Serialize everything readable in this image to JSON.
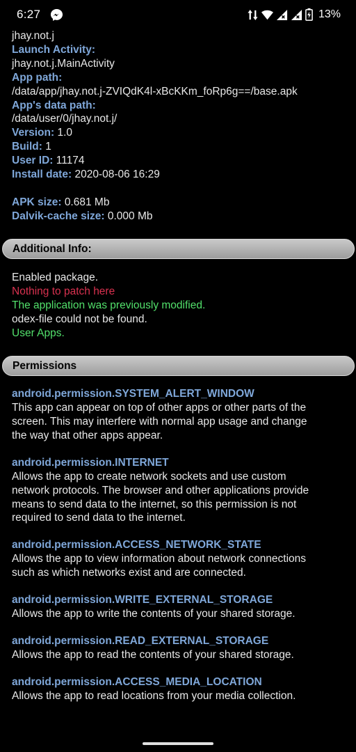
{
  "status_bar": {
    "time": "6:27",
    "battery_pct": "13%",
    "icons": [
      "messenger-icon",
      "data-arrows-icon",
      "wifi-icon",
      "signal-icon",
      "signal-icon",
      "battery-icon"
    ]
  },
  "app_info": {
    "package_value": "jhay.not.j",
    "launch_activity_label": "Launch Activity:",
    "launch_activity_value": "jhay.not.j.MainActivity",
    "app_path_label": "App path:",
    "app_path_value": "/data/app/jhay.not.j-ZVIQdK4l-xBcKKm_foRp6g==/base.apk",
    "data_path_label": "App's data path:",
    "data_path_value": "/data/user/0/jhay.not.j/",
    "version_label": "Version:",
    "version_value": "1.0",
    "build_label": "Build:",
    "build_value": "1",
    "user_id_label": "User ID:",
    "user_id_value": "11174",
    "install_date_label": "Install date:",
    "install_date_value": "2020-08-06 16:29",
    "apk_size_label": "APK size:",
    "apk_size_value": "0.681 Mb",
    "dalvik_label": "Dalvik-cache size:",
    "dalvik_value": "0.000 Mb"
  },
  "additional_info": {
    "title": "Additional Info:",
    "lines": {
      "enabled": "Enabled package.",
      "nothing": "Nothing to patch here",
      "modified": "The application was previously modified.",
      "odex": "odex-file could not be found.",
      "user_apps": "User Apps."
    },
    "colors": {
      "warning": "#d9314f",
      "ok": "#52e06b"
    }
  },
  "permissions": {
    "title": "Permissions",
    "items": [
      {
        "name": "android.permission.SYSTEM_ALERT_WINDOW",
        "desc": [
          "This app can appear on top of other apps or other parts of the",
          "screen. This may interfere with normal app usage and change",
          "the way that other apps appear."
        ]
      },
      {
        "name": "android.permission.INTERNET",
        "desc": [
          "Allows the app to create network sockets and use custom",
          "network protocols. The browser and other applications provide",
          "means to send data to the internet, so this permission is not",
          "required to send data to the internet."
        ]
      },
      {
        "name": "android.permission.ACCESS_NETWORK_STATE",
        "desc": [
          "Allows the app to view information about network connections",
          "such as which networks exist and are connected."
        ]
      },
      {
        "name": "android.permission.WRITE_EXTERNAL_STORAGE",
        "desc": [
          "Allows the app to write the contents of your shared storage."
        ]
      },
      {
        "name": "android.permission.READ_EXTERNAL_STORAGE",
        "desc": [
          "Allows the app to read the contents of your shared storage."
        ]
      },
      {
        "name": "android.permission.ACCESS_MEDIA_LOCATION",
        "desc": [
          "Allows the app to read locations from your media collection."
        ]
      }
    ]
  },
  "colors": {
    "label": "#7fa7d9",
    "background": "#000000",
    "section_bar": "#b4b4b4"
  }
}
